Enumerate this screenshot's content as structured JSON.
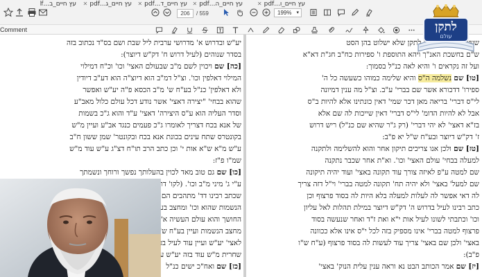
{
  "toolbar": {
    "pager_current": "206",
    "pager_total": "/ 559",
    "zoom": "199%",
    "comment_label": "Comment",
    "icons": [
      "star-icon",
      "print-icon",
      "email-icon",
      "search-icon",
      "up-icon",
      "down-icon",
      "cursor-icon",
      "hand-icon",
      "zoom-out-icon",
      "zoom-in-icon",
      "fit-icon",
      "comment-icon",
      "highlight-icon",
      "text-icon",
      "stamp-icon",
      "pen-icon",
      "shape-icon",
      "link-icon",
      "sign-icon",
      "fill-icon",
      "tag-icon",
      "pin-icon"
    ]
  },
  "tabs": [
    {
      "label": "עץ חיים_ב...pdf"
    },
    {
      "label": "עץ חיים_ג...pdf"
    },
    {
      "label": "עץ חיים_ד...pdf"
    },
    {
      "label": "עץ חיים_ה...pdf"
    },
    {
      "label": "עץ חיים_ו...pdf"
    }
  ],
  "logo": {
    "text": "לתקן",
    "subtext": "עולם"
  },
  "right_column": [
    {
      "text": "שעשתה היא בריתה לתקן שלא ישלוט בהן הסט"
    },
    {
      "text": "ש\"ם בחשכת האנ\"ך ויהא התוספת ו' ספירות כח\"ב חג\"ת דא\"א"
    },
    {
      "text": "ועל זה נקראים ו' והיא לאה כנ\"ל בסמוך:"
    },
    {
      "sec": "[טו] שם",
      "hl": "נשלמה ה\"ס",
      "text": "והיא שלימה כמוהו כשעשה כל ה'"
    },
    {
      "text": "ספירו' דדכורא אשר שם בברי' ע\"ב. וצ\"ל מה ענין דמיונה"
    },
    {
      "text": "לי\"ס דברי' בריאה מאן דכר שמי' דאין כונתינו אלא להיות ב\"ס"
    },
    {
      "text": "אבל לא להיות הדומ' לי\"ס דברי' דאין שייכות לה שם אלא"
    },
    {
      "text": "בז\"א דאצי' לא יהי דברי' (רק ג\"ר שהיא שם כנ\"ל) ריש דרוש"
    },
    {
      "text": "ז' דק\"ש דיוצר ובע\"ח ש\"ל יא פ\"ב:"
    },
    {
      "sec": "[טז] שם",
      "text": "ולכן אנו צריכים תיקון אחר והוא להשלימה ולתקנה"
    },
    {
      "text": "למעלה בבחי' עולם האצי' וכו'. וא\"ת אחר שכבר נתקנה"
    },
    {
      "text": "שם למטה ע\"פ לאיזה צורך עוד תקונה באצי' ועוד יהיה תיקונה"
    },
    {
      "text": "שם למעל' באצי' ולא יהיה תח' תקונה למטה בברי' וי\"ל דזה צריך"
    },
    {
      "text": "לה דאי אפשר לה לעלות למעלה בלא היות לה בסוד פרצוף וכן"
    },
    {
      "text": "כתב רבינו לעיל בדרוש ה' דק\"ש דיוצר במילת תהלות לאל עליון"
    },
    {
      "text": "וכו' וכתבתי לשונו לעיל אות י\"א ואת ז\"ד ואחר שנעשה בסוד"
    },
    {
      "text": "פרצוף למטה בברי' אינו מספיק בזה לכל י\"ס אינו אלא ככוונה"
    },
    {
      "text": "באצי' ולכן שם באצי' צריך עוד לעשות לה בסוד פרצוף (ע\"ח ש\"ו"
    },
    {
      "text": "פ\"ב):"
    },
    {
      "sec": "[יז] שם",
      "text": "אמר הכותב הבט נא וראה ענין עלית הנוק' באצי'"
    }
  ],
  "left_column": [
    {
      "text": "יע\"ש ובדרוש א' מדרושי ערבית ליל שבת ושם בס\"ד נכתוב בזה"
    },
    {
      "text": "בסדר שנוהים (לעיל דרוש ח' דק\"ש דיוצר):"
    },
    {
      "sec": "[כה] שם",
      "text": "ויכוין לשם מ\"ב שבעולם האצי' וכו' וכ\"ח דמילוי"
    },
    {
      "text": "המילוי דאלפין וכו'. וצ\"ל דמ\"ב הוא דיוצ\"ה הוא דע\"ב דיודין"
    },
    {
      "text": "ולא דאלפין' כנ\"ל בע\"ח ש' מ\"ב הכסא פ\"ה יע\"ש ואפשר"
    },
    {
      "text": "שהוא בבחי' \"יצירה דאצי' אשר נודע דכל עולם כלול מאב\"ע"
    },
    {
      "text": "וסדר העליה הוא ע\"ס היצירה' דאצי' ע\"ד והוא ג\"כ בשמות"
    },
    {
      "text": "של אנא בכח דצריך לאומרו ג\"כ פעמים כנגד אב\"ע ועיין מ\"ש"
    },
    {
      "text": "בקונטרס שתח עינים בכונת אנא בכח ובקונטר' שמן ששון ח\"ב"
    },
    {
      "text": "ע\"ש מ\"א ש\"א אות י' וכן כתב הרב תו\"ח דצ\"ג ע\"ש עוד מ\"ש"
    },
    {
      "text": "שמ\"ו פ\"ז:"
    },
    {
      "sec": "[כו] שם",
      "text": "גם טוב מאד לכוין בהעלותך נפשך ורוחך ונשמתך"
    },
    {
      "text": "ע\"י ג' מיני מ\"ב וכו'. (לקו' דרוש י') שתפלה מקודשה"
    },
    {
      "text": "שכתב רבינו דד' מתהבים הם הנפש והרוח ממצב הספירות"
    },
    {
      "text": "הנשמות שהוא וכו' ומחצב בעולם הברי' ומחצב מלאכי"
    },
    {
      "text": "החושך והוא עולם העשיה א\"כ כ\"ב דכתב"
    },
    {
      "text": "מחצב הנשמות ועיין בע\"ח ש\"ג"
    },
    {
      "text": "לאצי' יע\"ש ועיין עוד לעיל בכונת בעולם"
    },
    {
      "text": "שחרית מ\"ש עוד בזה יע\"ש עוד מ\"ש"
    },
    {
      "sec": "[כז] שם",
      "text": "ואח\"כ ישים כנ\"ל"
    }
  ]
}
